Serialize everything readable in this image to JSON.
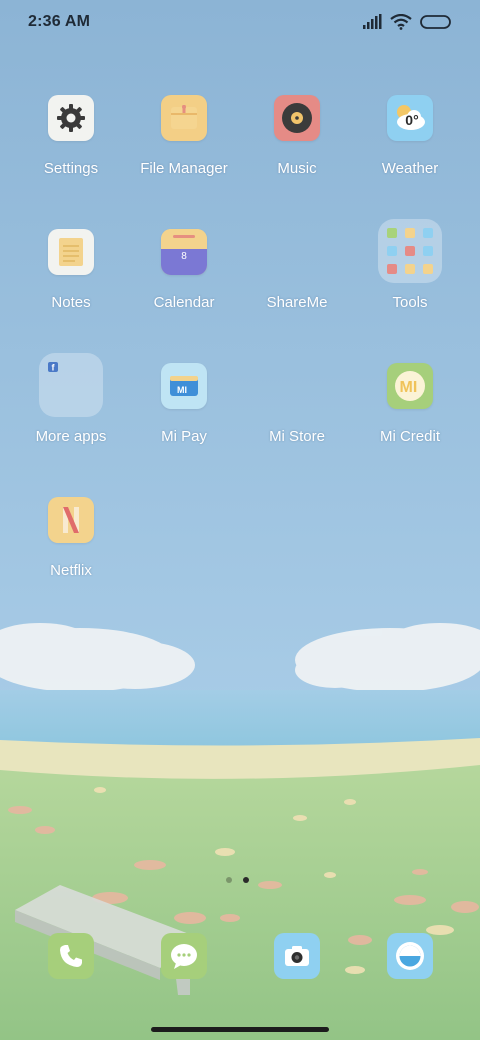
{
  "status_bar": {
    "time": "2:36 AM"
  },
  "home": {
    "apps": [
      {
        "label": "Settings"
      },
      {
        "label": "File Manager"
      },
      {
        "label": "Music"
      },
      {
        "label": "Weather",
        "icon_text": "0°"
      },
      {
        "label": "Notes"
      },
      {
        "label": "Calendar",
        "icon_text": "8"
      },
      {
        "label": "ShareMe"
      },
      {
        "label": "Tools"
      },
      {
        "label": "More apps"
      },
      {
        "label": "Mi Pay"
      },
      {
        "label": "Mi Store"
      },
      {
        "label": "Mi Credit"
      },
      {
        "label": "Netflix"
      }
    ]
  },
  "dock": {
    "apps": [
      {
        "icon": "phone-icon"
      },
      {
        "icon": "messages-icon"
      },
      {
        "icon": "camera-icon"
      },
      {
        "icon": "browser-icon"
      }
    ]
  },
  "pager": {
    "page_count": 2,
    "current_page": 2
  },
  "colors": {
    "sky_top": "#8fb6d6",
    "sky_bottom": "#a9cbe6",
    "water": "#8cc2dc",
    "sand": "#e9e6bf",
    "grass": "#9cc98a",
    "icon_bg": "#f2f3f0"
  }
}
